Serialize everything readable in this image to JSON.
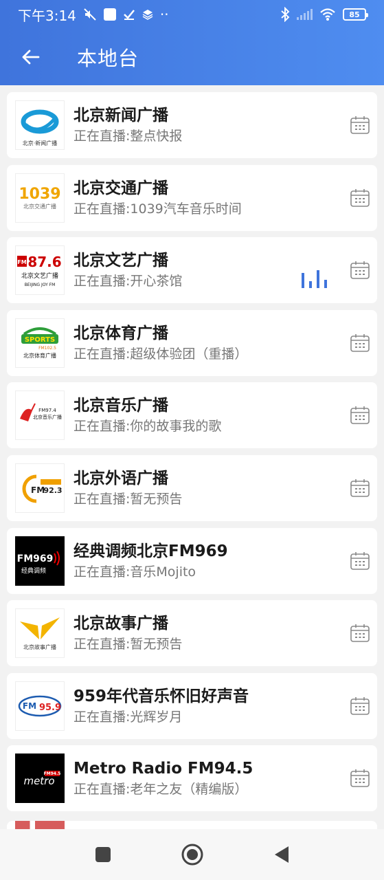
{
  "status_bar": {
    "time": "下午3:14",
    "dots": "··",
    "battery": "85"
  },
  "app_bar": {
    "title": "本地台"
  },
  "colors": {
    "header_start": "#3f74dc",
    "header_end": "#4f8df0",
    "accent": "#3f74dc"
  },
  "stations": [
    {
      "name": "北京新闻广播",
      "now_playing": "正在直播:整点快报",
      "logo_text": "北京·新闻广播",
      "logo_icon": "news-swirl-logo",
      "playing": false
    },
    {
      "name": "北京交通广播",
      "now_playing": "正在直播:1039汽车音乐时间",
      "logo_text": "北京交通广播",
      "logo_icon": "fm1039-logo",
      "logo_number": "1039",
      "playing": false
    },
    {
      "name": "北京文艺广播",
      "now_playing": "正在直播:开心茶馆",
      "logo_text": "北京文艺广播",
      "logo_icon": "fm876-logo",
      "logo_number": "87.6",
      "logo_sub": "BEIJING JOY FM",
      "playing": true
    },
    {
      "name": "北京体育广播",
      "now_playing": "正在直播:超级体验团（重播）",
      "logo_text": "北京体育广播",
      "logo_icon": "sports-logo",
      "logo_number": "SPORTS",
      "logo_sub": "FM102.5",
      "playing": false
    },
    {
      "name": "北京音乐广播",
      "now_playing": "正在直播:你的故事我的歌",
      "logo_text": "北京音乐广播",
      "logo_icon": "music-logo",
      "logo_number": "FM97.4",
      "playing": false
    },
    {
      "name": "北京外语广播",
      "now_playing": "正在直播:暂无预告",
      "logo_text": "FM 92.3",
      "logo_icon": "fm923-logo",
      "logo_number": "92.3",
      "playing": false
    },
    {
      "name": "经典调频北京FM969",
      "now_playing": "正在直播:音乐Mojito",
      "logo_text": "经典调频",
      "logo_icon": "fm969-logo",
      "logo_number": "FM969",
      "playing": false
    },
    {
      "name": "北京故事广播",
      "now_playing": "正在直播:暂无预告",
      "logo_text": "北京故事广播",
      "logo_icon": "story-logo",
      "playing": false
    },
    {
      "name": "959年代音乐怀旧好声音",
      "now_playing": "正在直播:光辉岁月",
      "logo_text": "FM 95.9",
      "logo_icon": "fm959-logo",
      "logo_number": "95.9",
      "playing": false
    },
    {
      "name": "Metro Radio FM94.5",
      "now_playing": "正在直播:老年之友（精编版）",
      "logo_text": "metro",
      "logo_icon": "metro-logo",
      "logo_number": "FM94.5",
      "playing": false
    }
  ]
}
